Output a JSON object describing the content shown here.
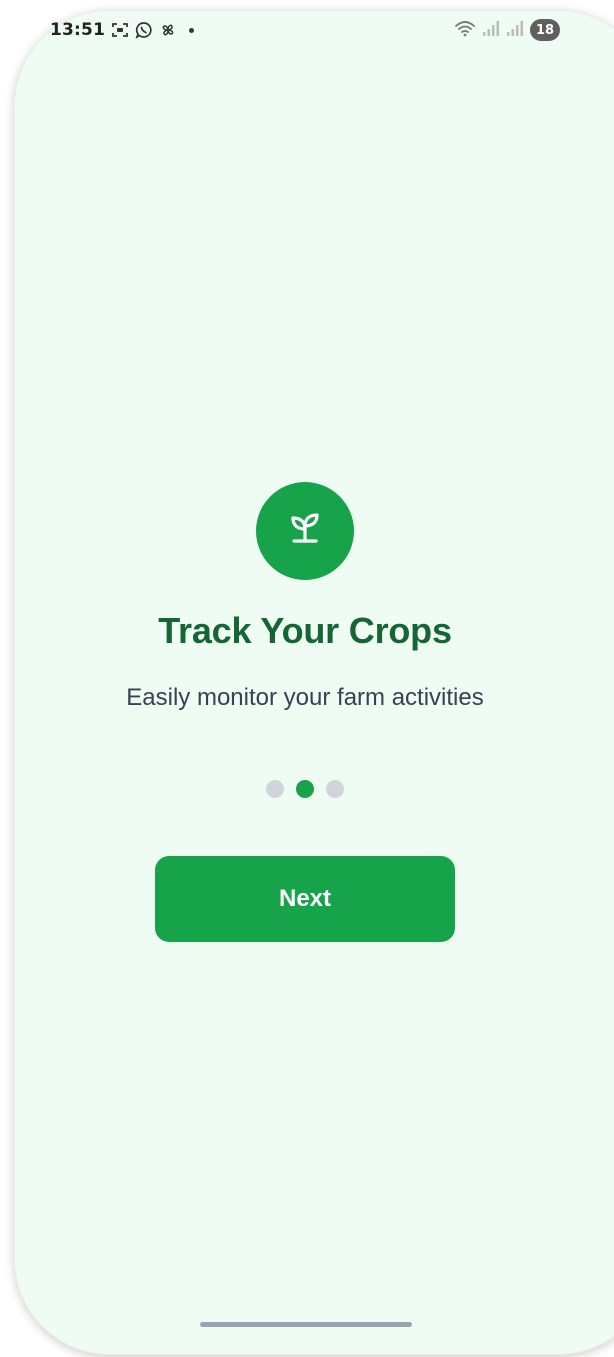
{
  "status_bar": {
    "time": "13:51",
    "battery": "18",
    "icons": [
      "screenshot-icon",
      "whatsapp-icon",
      "pinwheel-icon",
      "notification-dot",
      "wifi-icon",
      "signal-icon",
      "signal-icon-2"
    ]
  },
  "onboarding": {
    "logo_icon": "sprout-icon",
    "title": "Track Your Crops",
    "subtitle": "Easily monitor your farm activities",
    "page_count": 3,
    "active_page": 2,
    "next_label": "Next"
  },
  "colors": {
    "background": "#effcf3",
    "accent": "#16a34a",
    "title": "#166534",
    "subtitle": "#374151",
    "dot_inactive": "#d1d5db"
  }
}
